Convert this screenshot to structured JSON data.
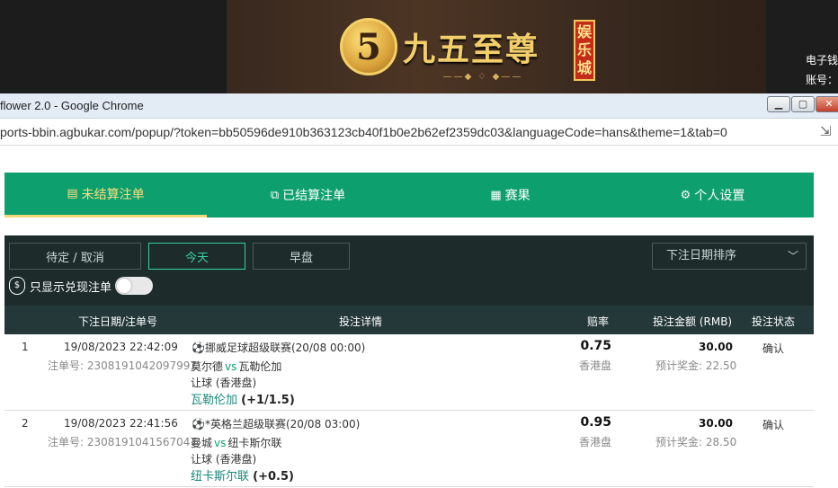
{
  "banner": {
    "logo_glyph": "5",
    "logo_text": "九五至尊",
    "logo_ornament": "——◆ ♢ ◆——",
    "badge_text": "娱乐城",
    "wallet_label": "电子钱",
    "account_label": "账号："
  },
  "browser": {
    "window_title": "flower 2.0 - Google Chrome",
    "url": "ports-bbin.agbukar.com/popup/?token=bb50596de910b363123cb40f1b0e2b62ef2359dc03&languageCode=hans&theme=1&tab=0",
    "min_glyph": "▁",
    "max_glyph": "▢",
    "close_glyph": "✕"
  },
  "nav": {
    "tabs": [
      {
        "label": "未结算注单",
        "icon": "bet-slip-icon"
      },
      {
        "label": "已结算注单",
        "icon": "settled-icon"
      },
      {
        "label": "赛果",
        "icon": "results-icon"
      },
      {
        "label": "个人设置",
        "icon": "gear-icon"
      }
    ],
    "active_tab": 0
  },
  "filters": {
    "pending_label": "待定 / 取消",
    "today_label": "今天",
    "early_label": "早盘",
    "sort_value": "下注日期排序",
    "cashout_label": "只显示兑现注单",
    "cashout_enabled": false
  },
  "table": {
    "headers": {
      "date_id": "下注日期/注单号",
      "details": "投注详情",
      "odds": "赔率",
      "stake": "投注金额 (RMB)",
      "status": "投注状态"
    },
    "rows": [
      {
        "no": "1",
        "date": "19/08/2023 22:42:09",
        "bet_id": "注单号: 2308191042097997",
        "league": "⚽挪威足球超级联赛(20/08 00:00)",
        "home": "莫尔德",
        "vs": "vs",
        "away": "瓦勒伦加",
        "market": "让球 (香港盘)",
        "pick_team": "瓦勒伦加",
        "pick_handicap": "(+1/1.5)",
        "odds": "0.75",
        "odds_type": "香港盘",
        "stake": "30.00",
        "payout": "预计奖金: 22.50",
        "status": "确认"
      },
      {
        "no": "2",
        "date": "19/08/2023 22:41:56",
        "bet_id": "注单号: 2308191041567047",
        "league": "⚽*英格兰超级联赛(20/08 03:00)",
        "home": "曼城",
        "vs": "vs",
        "away": "纽卡斯尔联",
        "market": "让球 (香港盘)",
        "pick_team": "纽卡斯尔联",
        "pick_handicap": "(+0.5)",
        "odds": "0.95",
        "odds_type": "香港盘",
        "stake": "30.00",
        "payout": "预计奖金: 28.50",
        "status": "确认"
      }
    ]
  },
  "colors": {
    "nav_green": "#0e9f6e",
    "panel_dark": "#1d2b2b",
    "active_yellow": "#f7e080",
    "today_accent": "#35d49c"
  }
}
